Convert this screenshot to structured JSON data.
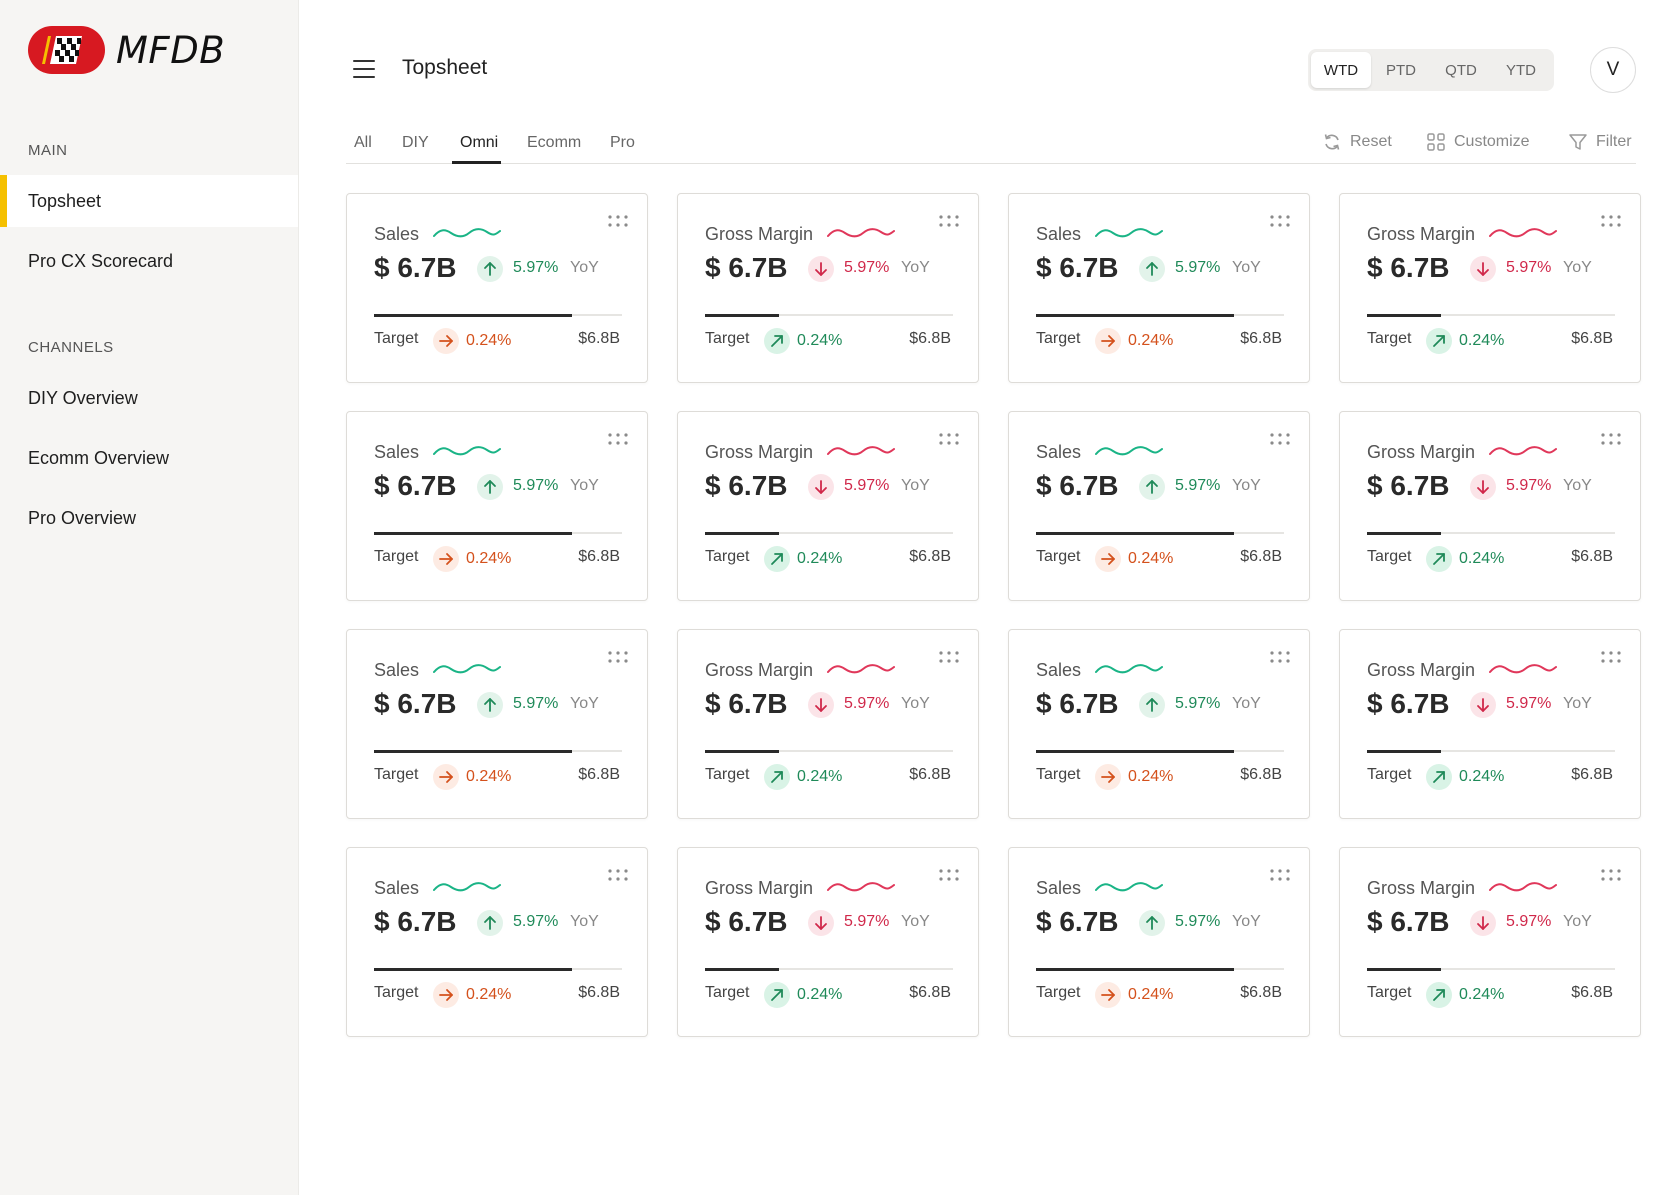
{
  "app": {
    "logo_text": "MFDB"
  },
  "sidebar": {
    "sections": [
      {
        "label": "MAIN",
        "items": [
          {
            "label": "Topsheet",
            "active": true
          },
          {
            "label": "Pro CX Scorecard",
            "active": false
          }
        ]
      },
      {
        "label": "CHANNELS",
        "items": [
          {
            "label": "DIY Overview",
            "active": false
          },
          {
            "label": "Ecomm Overview",
            "active": false
          },
          {
            "label": "Pro Overview",
            "active": false
          }
        ]
      }
    ]
  },
  "header": {
    "title": "Topsheet",
    "periods": [
      "WTD",
      "PTD",
      "QTD",
      "YTD"
    ],
    "active_period": "WTD",
    "avatar_initial": "V"
  },
  "tabs": {
    "items": [
      "All",
      "DIY",
      "Omni",
      "Ecomm",
      "Pro"
    ],
    "active": "Omni"
  },
  "toolbar": {
    "reset_label": "Reset",
    "customize_label": "Customize",
    "filter_label": "Filter"
  },
  "colors": {
    "positive": "#1f8a59",
    "negative": "#d0284a",
    "warning": "#d4511c",
    "accent": "#f5c000",
    "sparkline_green": "#1ab486",
    "sparkline_red": "#e0375a"
  },
  "cards": [
    {
      "title": "Sales",
      "value": "$ 6.7B",
      "yoy_pct": "5.97%",
      "yoy_label": "YoY",
      "yoy_direction": "up",
      "target_label": "Target",
      "target_pct": "0.24%",
      "target_direction": "right",
      "target_value": "$6.8B",
      "progress": 0.8
    },
    {
      "title": "Gross Margin",
      "value": "$ 6.7B",
      "yoy_pct": "5.97%",
      "yoy_label": "YoY",
      "yoy_direction": "down",
      "target_label": "Target",
      "target_pct": "0.24%",
      "target_direction": "diagonal-up",
      "target_value": "$6.8B",
      "progress": 0.3
    },
    {
      "title": "Sales",
      "value": "$ 6.7B",
      "yoy_pct": "5.97%",
      "yoy_label": "YoY",
      "yoy_direction": "up",
      "target_label": "Target",
      "target_pct": "0.24%",
      "target_direction": "right",
      "target_value": "$6.8B",
      "progress": 0.8
    },
    {
      "title": "Gross Margin",
      "value": "$ 6.7B",
      "yoy_pct": "5.97%",
      "yoy_label": "YoY",
      "yoy_direction": "down",
      "target_label": "Target",
      "target_pct": "0.24%",
      "target_direction": "diagonal-up",
      "target_value": "$6.8B",
      "progress": 0.3
    },
    {
      "title": "Sales",
      "value": "$ 6.7B",
      "yoy_pct": "5.97%",
      "yoy_label": "YoY",
      "yoy_direction": "up",
      "target_label": "Target",
      "target_pct": "0.24%",
      "target_direction": "right",
      "target_value": "$6.8B",
      "progress": 0.8
    },
    {
      "title": "Gross Margin",
      "value": "$ 6.7B",
      "yoy_pct": "5.97%",
      "yoy_label": "YoY",
      "yoy_direction": "down",
      "target_label": "Target",
      "target_pct": "0.24%",
      "target_direction": "diagonal-up",
      "target_value": "$6.8B",
      "progress": 0.3
    },
    {
      "title": "Sales",
      "value": "$ 6.7B",
      "yoy_pct": "5.97%",
      "yoy_label": "YoY",
      "yoy_direction": "up",
      "target_label": "Target",
      "target_pct": "0.24%",
      "target_direction": "right",
      "target_value": "$6.8B",
      "progress": 0.8
    },
    {
      "title": "Gross Margin",
      "value": "$ 6.7B",
      "yoy_pct": "5.97%",
      "yoy_label": "YoY",
      "yoy_direction": "down",
      "target_label": "Target",
      "target_pct": "0.24%",
      "target_direction": "diagonal-up",
      "target_value": "$6.8B",
      "progress": 0.3
    },
    {
      "title": "Sales",
      "value": "$ 6.7B",
      "yoy_pct": "5.97%",
      "yoy_label": "YoY",
      "yoy_direction": "up",
      "target_label": "Target",
      "target_pct": "0.24%",
      "target_direction": "right",
      "target_value": "$6.8B",
      "progress": 0.8
    },
    {
      "title": "Gross Margin",
      "value": "$ 6.7B",
      "yoy_pct": "5.97%",
      "yoy_label": "YoY",
      "yoy_direction": "down",
      "target_label": "Target",
      "target_pct": "0.24%",
      "target_direction": "diagonal-up",
      "target_value": "$6.8B",
      "progress": 0.3
    },
    {
      "title": "Sales",
      "value": "$ 6.7B",
      "yoy_pct": "5.97%",
      "yoy_label": "YoY",
      "yoy_direction": "up",
      "target_label": "Target",
      "target_pct": "0.24%",
      "target_direction": "right",
      "target_value": "$6.8B",
      "progress": 0.8
    },
    {
      "title": "Gross Margin",
      "value": "$ 6.7B",
      "yoy_pct": "5.97%",
      "yoy_label": "YoY",
      "yoy_direction": "down",
      "target_label": "Target",
      "target_pct": "0.24%",
      "target_direction": "diagonal-up",
      "target_value": "$6.8B",
      "progress": 0.3
    },
    {
      "title": "Sales",
      "value": "$ 6.7B",
      "yoy_pct": "5.97%",
      "yoy_label": "YoY",
      "yoy_direction": "up",
      "target_label": "Target",
      "target_pct": "0.24%",
      "target_direction": "right",
      "target_value": "$6.8B",
      "progress": 0.8
    },
    {
      "title": "Gross Margin",
      "value": "$ 6.7B",
      "yoy_pct": "5.97%",
      "yoy_label": "YoY",
      "yoy_direction": "down",
      "target_label": "Target",
      "target_pct": "0.24%",
      "target_direction": "diagonal-up",
      "target_value": "$6.8B",
      "progress": 0.3
    },
    {
      "title": "Sales",
      "value": "$ 6.7B",
      "yoy_pct": "5.97%",
      "yoy_label": "YoY",
      "yoy_direction": "up",
      "target_label": "Target",
      "target_pct": "0.24%",
      "target_direction": "right",
      "target_value": "$6.8B",
      "progress": 0.8
    },
    {
      "title": "Gross Margin",
      "value": "$ 6.7B",
      "yoy_pct": "5.97%",
      "yoy_label": "YoY",
      "yoy_direction": "down",
      "target_label": "Target",
      "target_pct": "0.24%",
      "target_direction": "diagonal-up",
      "target_value": "$6.8B",
      "progress": 0.3
    }
  ]
}
